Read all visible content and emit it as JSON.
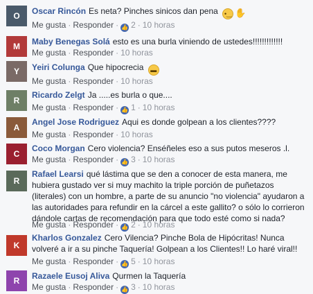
{
  "actions": {
    "like": "Me gusta",
    "reply": "Responder"
  },
  "comments": [
    {
      "author": "Oscar Rincón",
      "text": "Es neta? Pinches sinicos dan pena",
      "likes": "2",
      "time": "10 horas",
      "avatar_color": "#4a5a6a"
    },
    {
      "author": "Maby Benegas Solá",
      "text": "esto es una burla viniendo de ustedes!!!!!!!!!!!!!",
      "likes": "",
      "time": "10 horas",
      "avatar_color": "#b23a3a"
    },
    {
      "author": "Yeiri Colunga",
      "text": "Que hipocrecia",
      "likes": "",
      "time": "10 horas",
      "avatar_color": "#7a6a66"
    },
    {
      "author": "Ricardo Zelgt",
      "text": "Ja .....es burla o que....",
      "likes": "1",
      "time": "10 horas",
      "avatar_color": "#6e7f66"
    },
    {
      "author": "Angel Jose Rodriguez",
      "text": "Aqui es donde golpean a los clientes????",
      "likes": "",
      "time": "10 horas",
      "avatar_color": "#8a5a3a"
    },
    {
      "author": "Coco Morgan",
      "text": "Cero violencia? Enséñeles eso a sus putos meseros .l.",
      "likes": "3",
      "time": "10 horas",
      "avatar_color": "#9a2030"
    },
    {
      "author": "Rafael Learsi",
      "text": "qué lástima que se den a conocer de esta manera, me hubiera gustado ver si muy machito la triple porción de puñetazos (literales) con un hombre, a parte de su anuncio \"no violencia\" ayudaron a las autoridades para refundir en la cárcel a este gallito? o sólo lo corrieron dándole cartas de recomendación para que todo esté como si nada?",
      "likes": "2",
      "time": "10 horas",
      "avatar_color": "#5a6a5a"
    },
    {
      "author": "Kharlos Gonzalez",
      "text": "Cero Vilencia? Pinche Bola de Hipócritas! Nunca volveré a ir a su pinche Taquería! Golpean a los Clientes!! Lo haré viral!!",
      "likes": "5",
      "time": "10 horas",
      "avatar_color": "#c0392b"
    },
    {
      "author": "Razaele Eusoj Aliva",
      "text": "Qurmen la Taquería",
      "likes": "3",
      "time": "10 horas",
      "avatar_color": "#8e44ad"
    }
  ]
}
